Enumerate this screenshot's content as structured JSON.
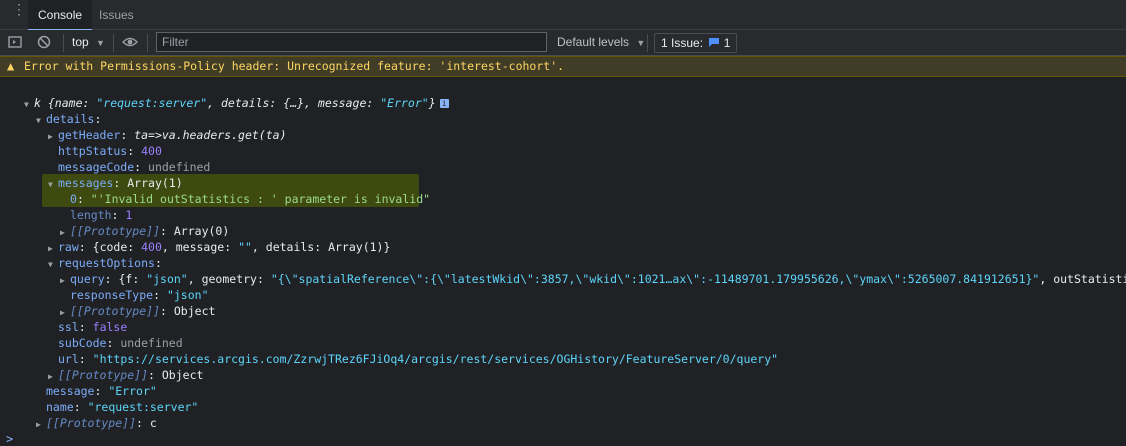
{
  "tabs": [
    {
      "label": "Console",
      "active": true
    },
    {
      "label": "Issues",
      "active": false
    }
  ],
  "toolbar": {
    "context": "top",
    "filter_placeholder": "Filter",
    "levels_label": "Default levels",
    "issues_label": "1 Issue:",
    "issues_count": "1"
  },
  "warning": {
    "text": "Error with Permissions-Policy header: Unrecognized feature: 'interest-cohort'."
  },
  "tree": {
    "l0_name": "k",
    "l0_summary_a": "{name: ",
    "l0_summary_b": "\"request:server\"",
    "l0_summary_c": ", details: {…}, message: ",
    "l0_summary_d": "\"Error\"",
    "l0_summary_e": "}",
    "details": "details",
    "getHeader_key": "getHeader",
    "getHeader_val": "ta=>va.headers.get(ta)",
    "httpStatus_key": "httpStatus",
    "httpStatus_val": "400",
    "messageCode_key": "messageCode",
    "messageCode_val": "undefined",
    "messages_key": "messages",
    "messages_val": "Array(1)",
    "msg0_key": "0",
    "msg0_val": "\"'Invalid outStatistics : ' parameter is invalid\"",
    "length_key": "length",
    "length_val": "1",
    "proto_key": "[[Prototype]]",
    "proto_arr": "Array(0)",
    "raw_key": "raw",
    "raw_val_a": "{code: ",
    "raw_val_b": "400",
    "raw_val_c": ", message: ",
    "raw_val_d": "\"\"",
    "raw_val_e": ", details: Array(1)}",
    "requestOptions_key": "requestOptions",
    "query_key": "query",
    "query_val_a": "{f: ",
    "query_val_b": "\"json\"",
    "query_val_c": ", geometry: ",
    "query_val_d": "\"{\\\"spatialReference\\\":{\\\"latestWkid\\\":3857,\\\"wkid\\\":1021…ax\\\":-11489701.179955626,\\\"ymax\\\":5265007.841912651}\"",
    "query_val_e": ", outStatistics: ",
    "query_val_f": "\"[{",
    "responseType_key": "responseType",
    "responseType_val": "\"json\"",
    "proto_obj": "Object",
    "ssl_key": "ssl",
    "ssl_val": "false",
    "subCode_key": "subCode",
    "subCode_val": "undefined",
    "url_key": "url",
    "url_val": "\"https://services.arcgis.com/ZzrwjTRez6FJiOq4/arcgis/rest/services/OGHistory/FeatureServer/0/query\"",
    "message_key": "message",
    "message_val": "\"Error\"",
    "name_key": "name",
    "name_val": "\"request:server\"",
    "proto_c": "c"
  }
}
